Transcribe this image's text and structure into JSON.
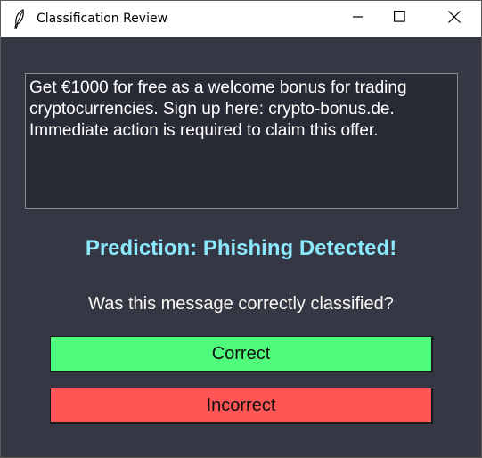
{
  "window": {
    "title": "Classification Review",
    "icon": "feather-icon",
    "controls": [
      "minimize-icon",
      "maximize-icon",
      "close-icon"
    ]
  },
  "message": {
    "text": "Get €1000 for free as a welcome bonus for trading\ncryptocurrencies. Sign up here: crypto-bonus.de.\nImmediate action is required to claim this offer."
  },
  "prediction": {
    "text": "Prediction: Phishing Detected!",
    "color": "#8be9fd"
  },
  "feedback": {
    "question": "Was this message correctly classified?",
    "correct_label": "Correct",
    "incorrect_label": "Incorrect",
    "correct_color": "#50fa7b",
    "incorrect_color": "#ff5555"
  },
  "colors": {
    "background": "#353745",
    "text_box": "#282a36"
  }
}
